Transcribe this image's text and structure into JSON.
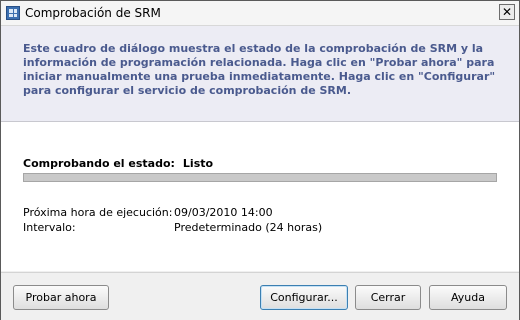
{
  "window": {
    "title": "Comprobación de SRM",
    "close_glyph": "✕"
  },
  "banner": {
    "text": "Este cuadro de diálogo muestra el estado de la comprobación de SRM y la información de programación relacionada. Haga clic en \"Probar ahora\" para iniciar manualmente una prueba inmediatamente. Haga clic en \"Configurar\" para configurar el servicio de comprobación de SRM."
  },
  "status": {
    "label": "Comprobando el estado:",
    "value": "Listo",
    "progress": 1.0
  },
  "schedule": {
    "next_run_label": "Próxima hora de ejecución:",
    "next_run_value": "09/03/2010 14:00",
    "interval_label": "Intervalo:",
    "interval_value": "Predeterminado (24 horas)"
  },
  "buttons": {
    "test_now": "Probar ahora",
    "configure": "Configurar...",
    "close": "Cerrar",
    "help": "Ayuda"
  },
  "colors": {
    "banner_bg": "#ececf4",
    "banner_text": "#4a5a8e",
    "default_button_border": "#3c7fb1"
  },
  "icons": {
    "title_icon": "window-app-icon",
    "close": "close-icon"
  }
}
